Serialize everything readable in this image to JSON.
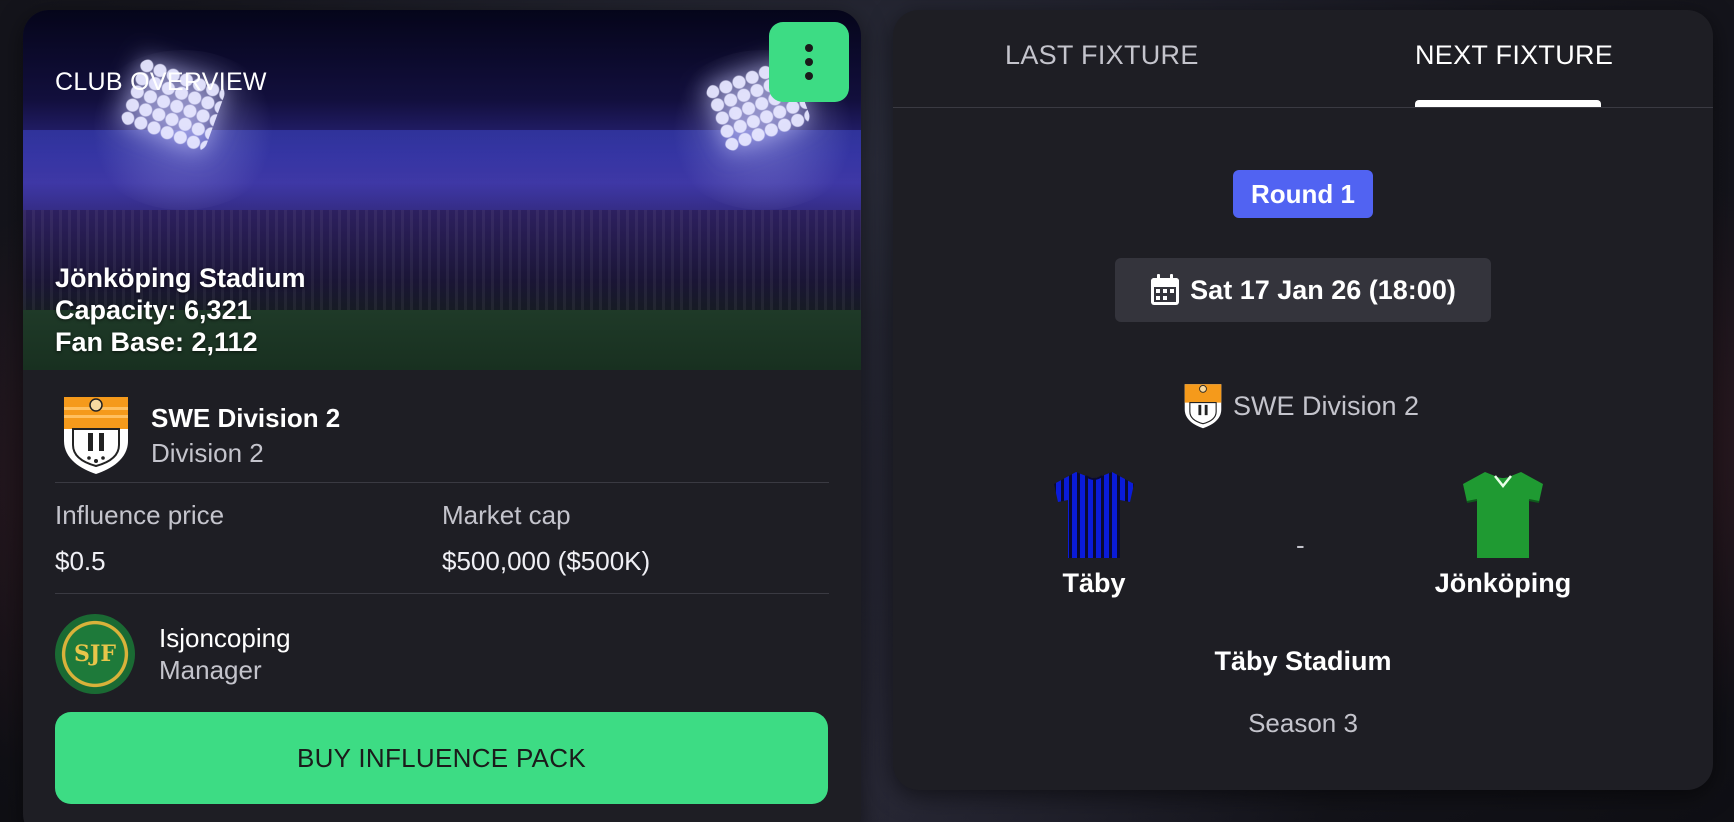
{
  "club_overview": {
    "title": "CLUB OVERVIEW",
    "stadium_name": "Jönköping Stadium",
    "capacity": "Capacity: 6,321",
    "fan_base": "Fan Base: 2,112",
    "league": {
      "name": "SWE Division 2",
      "division": "Division 2",
      "crest_icon": "league-shield-icon"
    },
    "influence_price": {
      "label": "Influence price",
      "value": "$0.5"
    },
    "market_cap": {
      "label": "Market cap",
      "value": "$500,000 ($500K)"
    },
    "manager": {
      "name": "Isjoncoping",
      "role": "Manager",
      "avatar_letters": "SJF"
    },
    "buy_button_label": "BUY INFLUENCE PACK"
  },
  "fixtures": {
    "tabs": [
      {
        "label": "LAST FIXTURE",
        "active": false
      },
      {
        "label": "NEXT FIXTURE",
        "active": true
      }
    ],
    "round": "Round 1",
    "date": "Sat 17 Jan 26 (18:00)",
    "league": "SWE Division 2",
    "home_team": {
      "name": "Täby",
      "kit": "blue-striped-jersey-icon"
    },
    "away_team": {
      "name": "Jönköping",
      "kit": "green-jersey-icon"
    },
    "separator": "-",
    "venue": "Täby Stadium",
    "season": "Season 3"
  },
  "colors": {
    "accent_green": "#3ddc84",
    "round_badge": "#5163f2",
    "card_bg": "#1e1e24"
  }
}
